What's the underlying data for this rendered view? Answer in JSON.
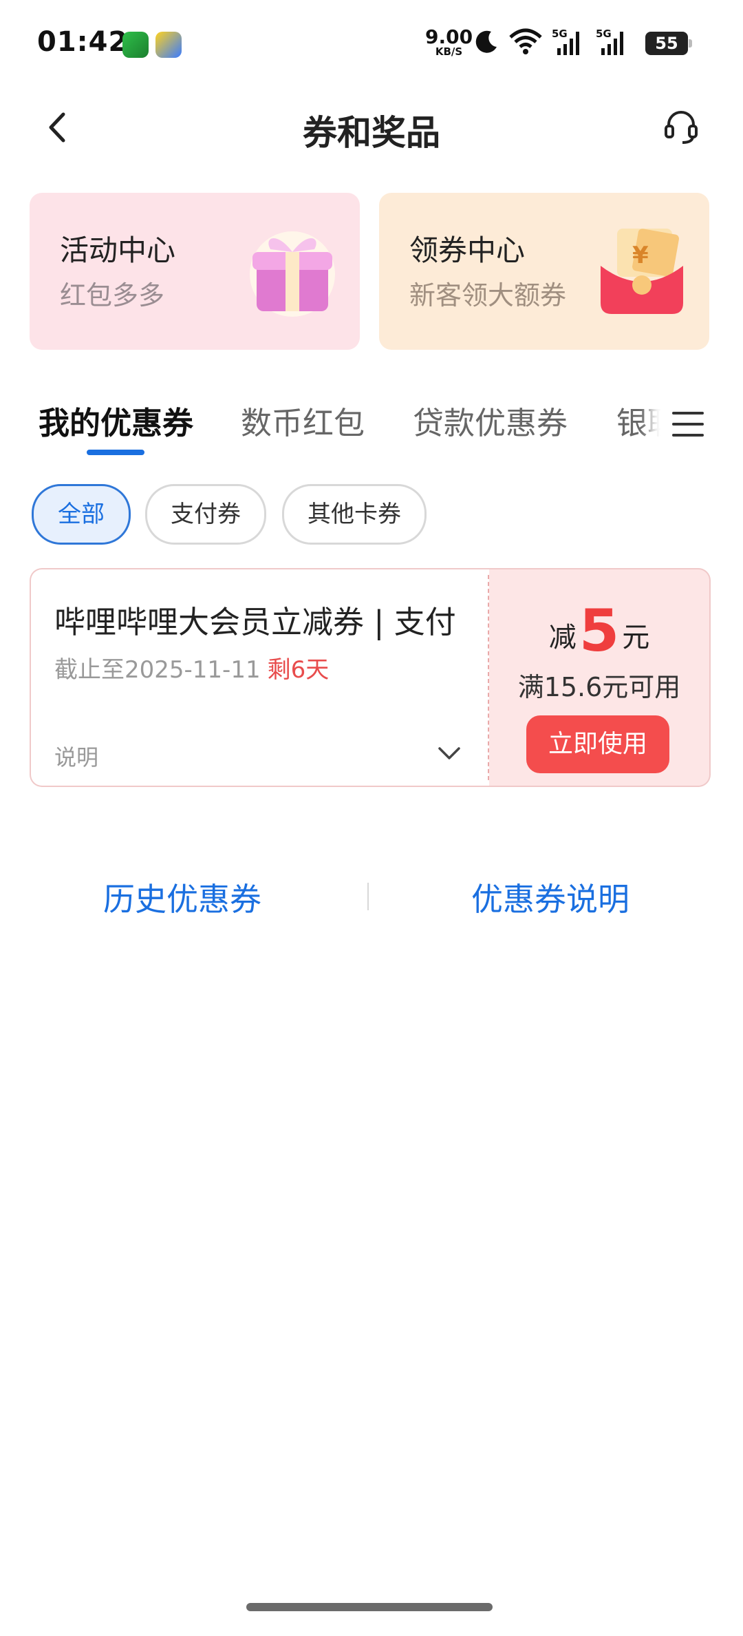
{
  "status_bar": {
    "time": "01:42",
    "net_speed_value": "9.00",
    "net_speed_unit": "KB/S",
    "network_1": "5G",
    "network_2": "5G",
    "battery": "55"
  },
  "header": {
    "title": "券和奖品",
    "back_icon": "chevron-left-icon",
    "service_icon": "headset-icon"
  },
  "promo_cards": [
    {
      "title": "活动中心",
      "subtitle": "红包多多",
      "icon": "gift-box-icon"
    },
    {
      "title": "领券中心",
      "subtitle": "新客领大额券",
      "icon": "red-envelope-icon"
    }
  ],
  "tabs": [
    {
      "label": "我的优惠券",
      "active": true
    },
    {
      "label": "数币红包",
      "active": false
    },
    {
      "label": "贷款优惠券",
      "active": false
    },
    {
      "label": "银联",
      "active": false
    }
  ],
  "filters": [
    {
      "label": "全部",
      "active": true
    },
    {
      "label": "支付券",
      "active": false
    },
    {
      "label": "其他卡券",
      "active": false
    }
  ],
  "coupon": {
    "title": "哔哩哔哩大会员立减券 | 支付",
    "expire_text": "截止至2025-11-11",
    "days_left": "剩6天",
    "desc_label": "说明",
    "discount_prefix": "减",
    "discount_amount": "5",
    "discount_unit": "元",
    "threshold": "满15.6元可用",
    "use_button": "立即使用"
  },
  "bottom_links": {
    "history": "历史优惠券",
    "explain": "优惠券说明"
  },
  "colors": {
    "accent_blue": "#1a6fe0",
    "coupon_red": "#ef3e3e",
    "button_red": "#f44d4d"
  }
}
